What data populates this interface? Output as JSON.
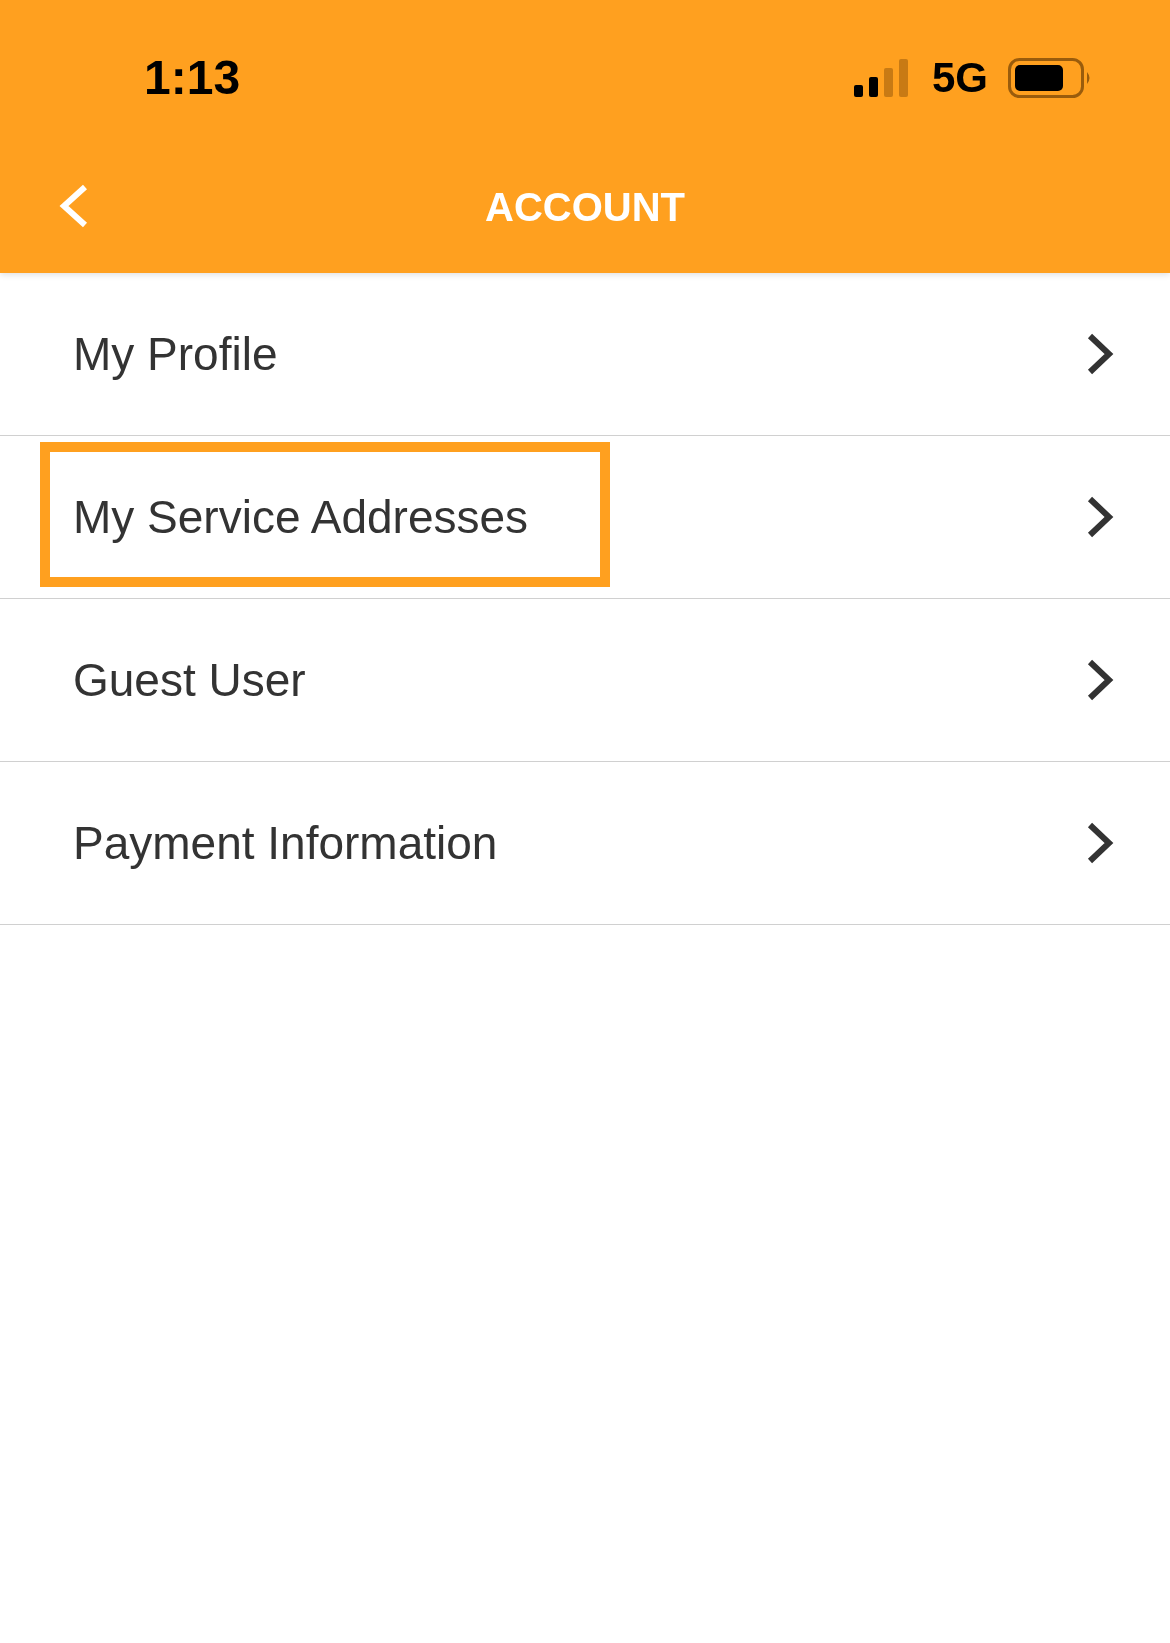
{
  "status_bar": {
    "time": "1:13",
    "network": "5G"
  },
  "header": {
    "title": "ACCOUNT"
  },
  "items": [
    {
      "label": "My Profile",
      "selected": false
    },
    {
      "label": "My Service Addresses",
      "selected": true
    },
    {
      "label": "Guest User",
      "selected": false
    },
    {
      "label": "Payment Information",
      "selected": false
    }
  ]
}
